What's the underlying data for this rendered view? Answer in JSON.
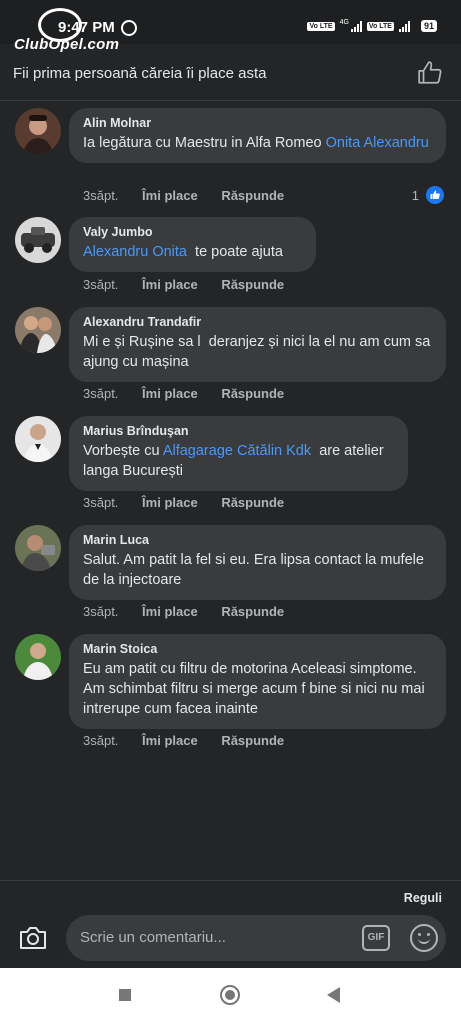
{
  "status_bar": {
    "time": "9:47 PM",
    "logo_text": "ClubOpel.com",
    "volte_label": "Vo LTE",
    "network": "4G",
    "battery": "91"
  },
  "header": {
    "text": "Fii prima persoană căreia îi place asta",
    "icon": "thumbs-up-outline-icon"
  },
  "comments": [
    {
      "author": "Alin Molnar",
      "text": "Ia legătura cu Maestru in Alfa Romeo ",
      "link": "Onita Alexandru",
      "text_after": "",
      "age": "3săpt.",
      "like": "Îmi place",
      "reply": "Răspunde",
      "reactions": "1"
    },
    {
      "author": "Valy Jumbo",
      "text": "",
      "link": "Alexandru Onita",
      "text_after": "  te poate ajuta",
      "age": "3săpt.",
      "like": "Îmi place",
      "reply": "Răspunde"
    },
    {
      "author": "Alexandru Trandafir",
      "text": "Mi e și Rușine sa l  deranjez și nici la el nu am cum sa ajung cu mașina",
      "age": "3săpt.",
      "like": "Îmi place",
      "reply": "Răspunde"
    },
    {
      "author": "Marius Brînduşan",
      "text": "Vorbește cu ",
      "link": "Alfagarage Cătălin Kdk",
      "text_after": "  are atelier langa București",
      "age": "3săpt.",
      "like": "Îmi place",
      "reply": "Răspunde"
    },
    {
      "author": "Marin Luca",
      "text": "Salut. Am patit la fel si eu. Era lipsa contact la mufele de la injectoare",
      "age": "3săpt.",
      "like": "Îmi place",
      "reply": "Răspunde"
    },
    {
      "author": "Marin Stoica",
      "text": "Eu am patit cu filtru de motorina Aceleasi simptome. Am schimbat filtru si merge acum f bine si nici nu mai intrerupe cum facea inainte",
      "age": "3săpt.",
      "like": "Îmi place",
      "reply": "Răspunde"
    }
  ],
  "footer": {
    "rules": "Reguli",
    "input_placeholder": "Scrie un comentariu...",
    "gif_label": "GIF"
  },
  "colors": {
    "background": "#242526",
    "bubble": "#3a3b3c",
    "link": "#4599ff",
    "like_blue": "#1877f2"
  }
}
